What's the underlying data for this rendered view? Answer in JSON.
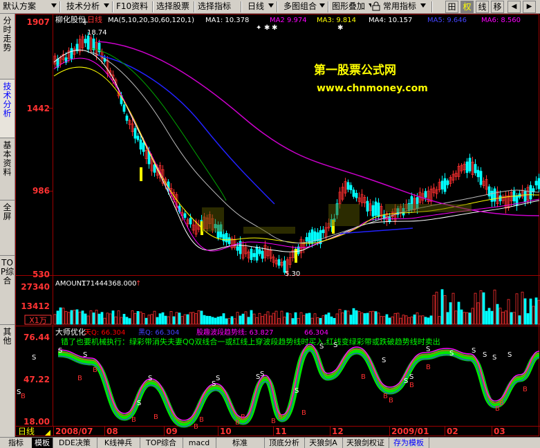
{
  "toolbar": {
    "items": [
      "默认方案",
      "技术分析",
      "F10资料",
      "选择股票",
      "选择指标",
      "日线",
      "多图组合",
      "图形叠加",
      "常用指标"
    ],
    "buttons": [
      "田",
      "权",
      "线",
      "移"
    ]
  },
  "sidebar": {
    "tabs": [
      "分时走势",
      "技术分析",
      "基本资料",
      "全屏",
      "TOP综合",
      "其他"
    ],
    "active": "技术分析"
  },
  "bottom_tabs": [
    "指标",
    "模板",
    "DDE决策",
    "K线神兵",
    "TOP综合",
    "macd",
    "标准",
    "顶底分析",
    "天狼剑A",
    "天狼剑权证",
    "存为模板"
  ],
  "main_panel": {
    "stock_name": "柳化股份",
    "period": "日线",
    "ma_label": "MA(5,10,20,30,60,120,1)",
    "ma_values": [
      {
        "label": "MA1:",
        "value": "10.378",
        "color": "#ffffff"
      },
      {
        "label": "MA2",
        "value": "9.974",
        "color": "#ff00ff"
      },
      {
        "label": "MA3:",
        "value": "9.814",
        "color": "#ffff00"
      },
      {
        "label": "MA4:",
        "value": "10.157",
        "color": "#ffffff"
      },
      {
        "label": "MA5:",
        "value": "9.646",
        "color": "#0000ff"
      },
      {
        "label": "MA6:",
        "value": "8.560",
        "color": "#ff00ff"
      }
    ],
    "y_ticks": [
      "1907",
      "1442",
      "986",
      "530"
    ],
    "high_label": "18.74",
    "low_label": "5.30",
    "watermark_cn": "第一股票公式网",
    "watermark_url": "www.chnmoney.com"
  },
  "volume_panel": {
    "title": "AMOUNT",
    "value": "171444368.000",
    "y_ticks": [
      "27340",
      "13412"
    ],
    "unit": "X1万"
  },
  "indicator_panel": {
    "title": "大师优化",
    "lines": [
      {
        "label": "天Q:",
        "value": "66.304",
        "color": "#ff0000"
      },
      {
        "label": "黑Q:",
        "value": "66.304",
        "color": "#0000ff"
      },
      {
        "label": "股趣波段趋势线:",
        "value": "63.827",
        "color": "#ff00ff"
      },
      {
        "label": "",
        "value": "66.304",
        "color": "#ff00ff"
      }
    ],
    "note": "错了也要机械执行：绿彩带消失夫妻QQ双线合一或红线上穿波段趋势线时买入,红线变绿彩带或跌破趋势线时卖出",
    "y_ticks": [
      "76.44",
      "47.22",
      "18.00"
    ]
  },
  "x_axis": {
    "period_label": "日线",
    "labels": [
      "2008/07",
      "08",
      "09",
      "10",
      "11",
      "12",
      "2009/01",
      "02",
      "03"
    ]
  }
}
